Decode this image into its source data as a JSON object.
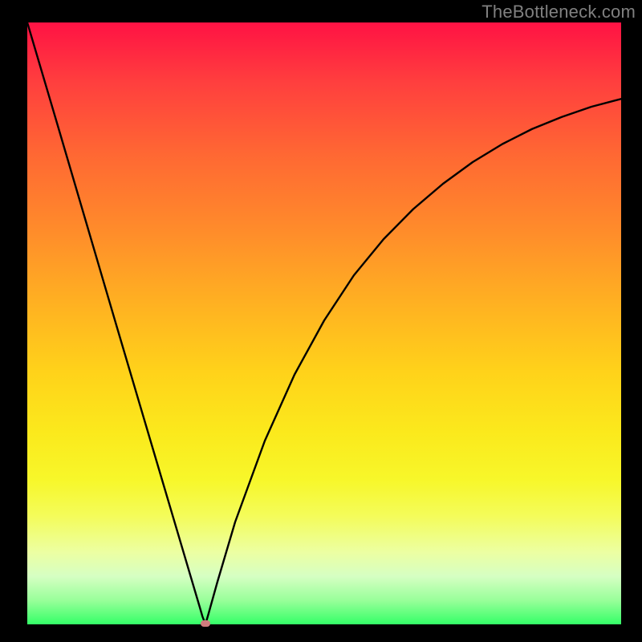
{
  "watermark": "TheBottleneck.com",
  "chart_data": {
    "type": "line",
    "title": "",
    "xlabel": "",
    "ylabel": "",
    "xlim": [
      0,
      100
    ],
    "ylim": [
      0,
      100
    ],
    "grid": false,
    "legend": false,
    "series": [
      {
        "name": "bottleneck-curve",
        "x": [
          0,
          5,
          10,
          15,
          20,
          23,
          26,
          29,
          29.5,
          30,
          30.5,
          32,
          35,
          40,
          45,
          50,
          55,
          60,
          65,
          70,
          75,
          80,
          85,
          90,
          95,
          100
        ],
        "values": [
          100,
          83.3,
          66.5,
          49.7,
          33.0,
          23.0,
          13.0,
          3.0,
          1.3,
          0.0,
          1.7,
          7.0,
          17.0,
          30.5,
          41.5,
          50.5,
          58.0,
          64.0,
          69.0,
          73.2,
          76.8,
          79.8,
          82.3,
          84.3,
          86.0,
          87.3
        ]
      }
    ],
    "marker": {
      "x": 30,
      "y": 0
    }
  },
  "colors": {
    "curve": "#000000",
    "marker": "#cf7b7d",
    "frame": "#000000"
  }
}
